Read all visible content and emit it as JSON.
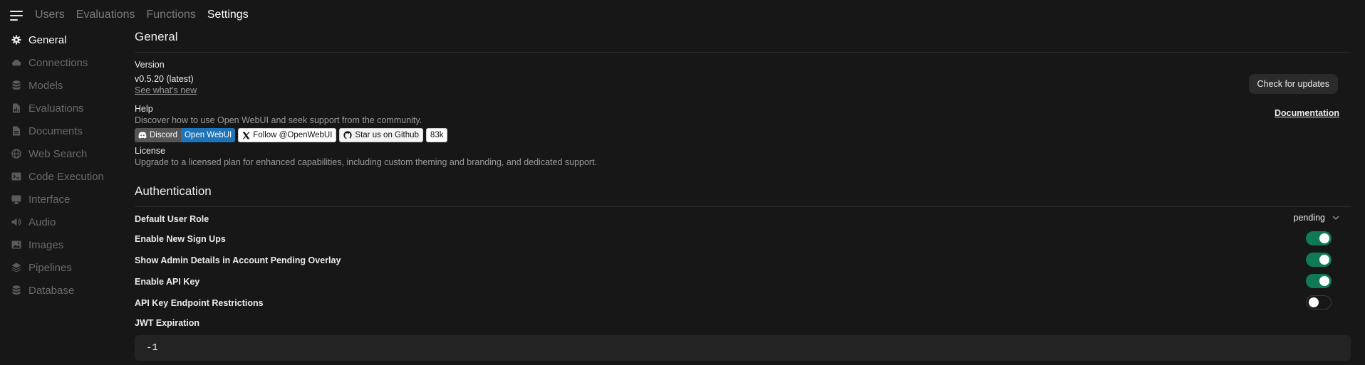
{
  "topnav": {
    "tabs": [
      {
        "label": "Users"
      },
      {
        "label": "Evaluations"
      },
      {
        "label": "Functions"
      },
      {
        "label": "Settings"
      }
    ]
  },
  "sidebar": {
    "items": [
      {
        "label": "General",
        "icon": "gear-icon"
      },
      {
        "label": "Connections",
        "icon": "cloud-icon"
      },
      {
        "label": "Models",
        "icon": "database-icon"
      },
      {
        "label": "Evaluations",
        "icon": "document-chart-icon"
      },
      {
        "label": "Documents",
        "icon": "document-icon"
      },
      {
        "label": "Web Search",
        "icon": "globe-icon"
      },
      {
        "label": "Code Execution",
        "icon": "terminal-icon"
      },
      {
        "label": "Interface",
        "icon": "monitor-icon"
      },
      {
        "label": "Audio",
        "icon": "speaker-icon"
      },
      {
        "label": "Images",
        "icon": "image-icon"
      },
      {
        "label": "Pipelines",
        "icon": "layers-icon"
      },
      {
        "label": "Database",
        "icon": "database-icon"
      }
    ]
  },
  "general": {
    "title": "General",
    "version_label": "Version",
    "version_value": "v0.5.20 (latest)",
    "whats_new": "See what's new",
    "check_updates": "Check for updates",
    "help_label": "Help",
    "help_text": "Discover how to use Open WebUI and seek support from the community.",
    "documentation": "Documentation",
    "badges": {
      "discord_left": "Discord",
      "discord_right": "Open WebUI",
      "x_label": "Follow @OpenWebUI",
      "github_label": "Star us on Github",
      "github_count": "83k"
    },
    "license_label": "License",
    "license_text": "Upgrade to a licensed plan for enhanced capabilities, including custom theming and branding, and dedicated support."
  },
  "auth": {
    "title": "Authentication",
    "default_role_label": "Default User Role",
    "default_role_value": "pending",
    "rows": [
      {
        "label": "Enable New Sign Ups",
        "on": true
      },
      {
        "label": "Show Admin Details in Account Pending Overlay",
        "on": true
      },
      {
        "label": "Enable API Key",
        "on": true
      },
      {
        "label": "API Key Endpoint Restrictions",
        "on": false
      }
    ],
    "jwt_label": "JWT Expiration",
    "jwt_value": "-1"
  },
  "colors": {
    "background": "#171717",
    "toggle_on": "#0f7a55",
    "discord_blue": "#1e74b8",
    "badge_grey": "#555555"
  }
}
